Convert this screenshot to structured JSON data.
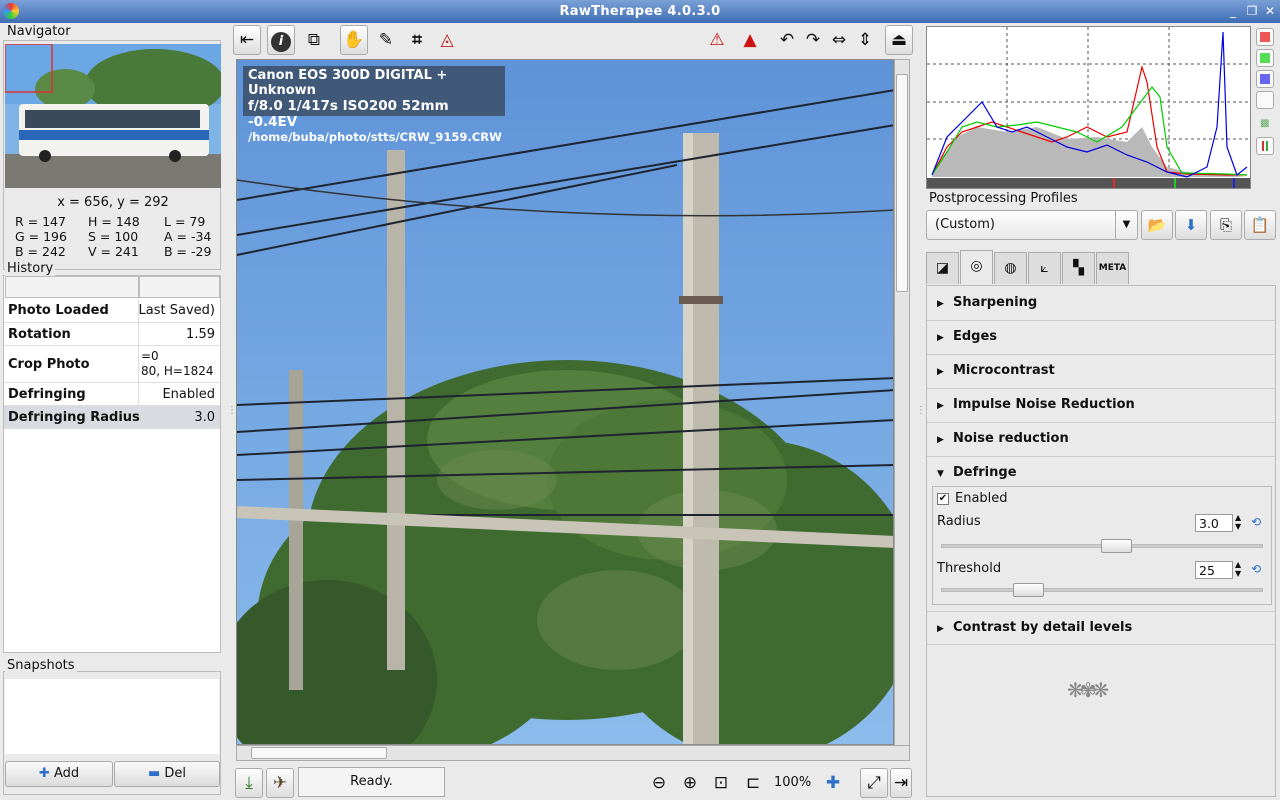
{
  "window": {
    "title": "RawTherapee 4.0.3.0"
  },
  "navigator": {
    "label": "Navigator",
    "coords": "x = 656, y = 292",
    "readout": [
      [
        "R = 147",
        "H = 148",
        "L = 79"
      ],
      [
        "G = 196",
        "S = 100",
        "A = -34"
      ],
      [
        "B = 242",
        "V = 241",
        "B = -29"
      ]
    ]
  },
  "history": {
    "label": "History",
    "rows": [
      {
        "name": "Photo Loaded",
        "value": "Last Saved)"
      },
      {
        "name": "Rotation",
        "value": "1.59"
      },
      {
        "name": "Crop Photo",
        "value": "=0",
        "value2": "80, H=1824"
      },
      {
        "name": "Defringing",
        "value": "Enabled"
      },
      {
        "name": "Defringing Radius",
        "value": "3.0"
      }
    ]
  },
  "snapshots": {
    "label": "Snapshots",
    "add": "Add",
    "del": "Del"
  },
  "exif": {
    "camera": "Canon EOS 300D DIGITAL + Unknown",
    "settings": "f/8.0  1/417s  ISO200  52mm  -0.4EV",
    "path": "/home/buba/photo/stts/CRW_9159.CRW"
  },
  "statusbar": {
    "status": "Ready.",
    "zoom": "100%"
  },
  "profiles": {
    "label": "Postprocessing Profiles",
    "selected": "(Custom)"
  },
  "tools": {
    "sharpening": "Sharpening",
    "edges": "Edges",
    "microcontrast": "Microcontrast",
    "impulse": "Impulse Noise Reduction",
    "noise": "Noise reduction",
    "defringe": "Defringe",
    "enabled": "Enabled",
    "radius_label": "Radius",
    "radius_value": "3.0",
    "threshold_label": "Threshold",
    "threshold_value": "25",
    "contrast": "Contrast by detail levels"
  },
  "icons": [
    "history-toggle-icon",
    "info-icon",
    "before-after-icon",
    "hand-icon",
    "color-picker-icon",
    "crop-icon",
    "straighten-icon",
    "warning-highlights-icon",
    "warning-shadows-icon",
    "rotate-left-icon",
    "rotate-right-icon",
    "flip-horizontal-icon",
    "flip-vertical-icon",
    "hide-toolbar-icon"
  ]
}
